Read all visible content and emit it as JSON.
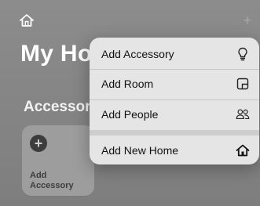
{
  "header": {
    "home_icon": "house-outline-icon",
    "add_icon": "plus-icon",
    "add_glyph": "+",
    "title": "My Ho"
  },
  "section": {
    "title": "Accessor"
  },
  "tile": {
    "icon": "plus-circle-icon",
    "icon_glyph": "+",
    "label": "Add Accessory"
  },
  "menu": {
    "items": [
      {
        "label": "Add Accessory",
        "icon": "lightbulb-icon"
      },
      {
        "label": "Add Room",
        "icon": "room-icon"
      },
      {
        "label": "Add People",
        "icon": "people-icon"
      },
      {
        "label": "Add New Home",
        "icon": "house-icon"
      }
    ]
  },
  "colors": {
    "background": "#858585",
    "menu_background": "#e5e5e5",
    "title_text": "#ffffff",
    "menu_text": "#111111"
  }
}
